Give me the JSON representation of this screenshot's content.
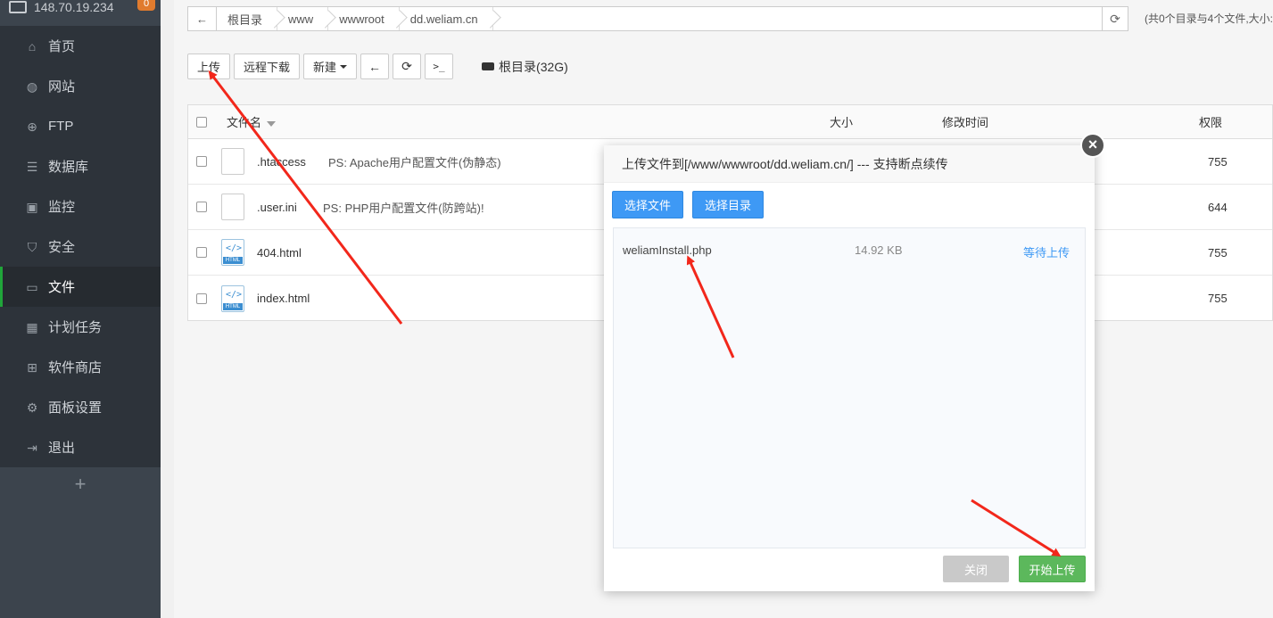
{
  "sidebar": {
    "ip": "148.70.19.234",
    "badge": "0",
    "items": [
      {
        "label": "首页",
        "icon": "home-icon",
        "glyph": "⌂"
      },
      {
        "label": "网站",
        "icon": "globe-icon",
        "glyph": "◍"
      },
      {
        "label": "FTP",
        "icon": "ftp-icon",
        "glyph": "⊕"
      },
      {
        "label": "数据库",
        "icon": "database-icon",
        "glyph": "☰"
      },
      {
        "label": "监控",
        "icon": "monitor-icon",
        "glyph": "▣"
      },
      {
        "label": "安全",
        "icon": "shield-icon",
        "glyph": "⛉"
      },
      {
        "label": "文件",
        "icon": "folder-icon",
        "glyph": "▭"
      },
      {
        "label": "计划任务",
        "icon": "calendar-icon",
        "glyph": "▦"
      },
      {
        "label": "软件商店",
        "icon": "apps-icon",
        "glyph": "⊞"
      },
      {
        "label": "面板设置",
        "icon": "gear-icon",
        "glyph": "⚙"
      },
      {
        "label": "退出",
        "icon": "logout-icon",
        "glyph": "⇥"
      }
    ],
    "plus": "+"
  },
  "path": {
    "back": "←",
    "crumbs": [
      "根目录",
      "www",
      "wwwroot",
      "dd.weliam.cn"
    ],
    "refresh": "⟳",
    "summary": "(共0个目录与4个文件,大小:"
  },
  "toolbar": {
    "upload": "上传",
    "remote_download": "远程下载",
    "new": "新建",
    "back_icon": "←",
    "refresh_icon": "⟳",
    "terminal_icon": ">_",
    "disk": "根目录(32G)"
  },
  "table": {
    "headers": {
      "name": "文件名",
      "size": "大小",
      "time": "修改时间",
      "perm": "权限"
    },
    "rows": [
      {
        "name": ".htaccess",
        "ps": "PS: Apache用户配置文件(伪静态)",
        "perm": "755",
        "type": "plain"
      },
      {
        "name": ".user.ini",
        "ps": "PS: PHP用户配置文件(防跨站)!",
        "perm": "644",
        "type": "plain"
      },
      {
        "name": "404.html",
        "ps": "",
        "perm": "755",
        "type": "html"
      },
      {
        "name": "index.html",
        "ps": "",
        "perm": "755",
        "type": "html"
      }
    ],
    "html_tag": "</>",
    "html_label": "HTML"
  },
  "dialog": {
    "title": "上传文件到[/www/wwwroot/dd.weliam.cn/] --- 支持断点续传",
    "close_icon": "×",
    "select_file": "选择文件",
    "select_dir": "选择目录",
    "file": {
      "name": "weliamInstall.php",
      "size": "14.92 KB",
      "status": "等待上传"
    },
    "close_label": "关闭",
    "start_label": "开始上传"
  }
}
